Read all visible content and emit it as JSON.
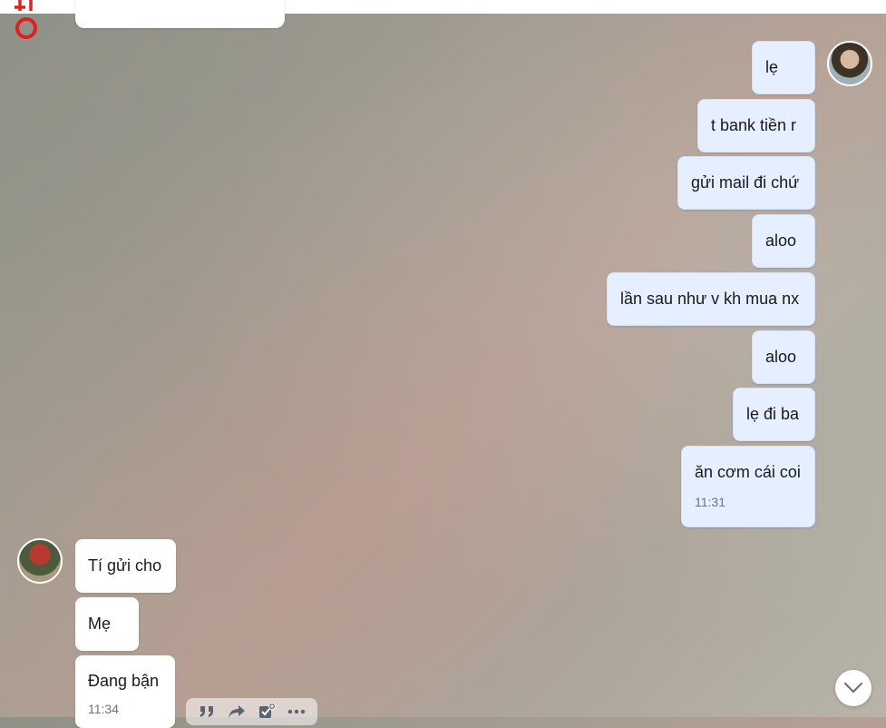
{
  "sent_messages": [
    {
      "text": "lẹ"
    },
    {
      "text": "t bank tiền r"
    },
    {
      "text": "gửi mail đi chứ"
    },
    {
      "text": "aloo"
    },
    {
      "text": "lần sau như v kh mua nx"
    },
    {
      "text": "aloo"
    },
    {
      "text": "lẹ đi ba"
    },
    {
      "text": "ăn cơm cái coi",
      "time": "11:31"
    }
  ],
  "received_messages": [
    {
      "text": "Tí gửi cho"
    },
    {
      "text": "Mẹ"
    },
    {
      "text": "Đang bận",
      "time": "11:34"
    }
  ],
  "message_actions": [
    "quote-icon",
    "forward-icon",
    "add-task-icon",
    "more-icon"
  ],
  "colors": {
    "sent_bubble": "#e5efff",
    "received_bubble": "#ffffff"
  }
}
